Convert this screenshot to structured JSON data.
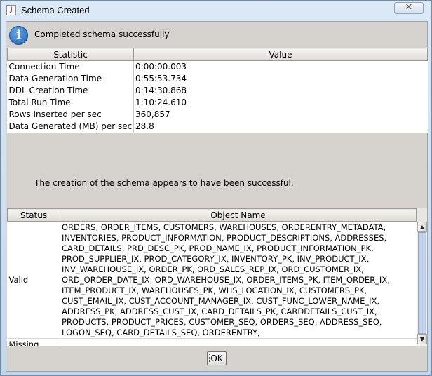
{
  "window": {
    "title": "Schema Created",
    "close_glyph": "✕"
  },
  "info": {
    "icon": "info-icon",
    "glyph": "i",
    "message": "Completed schema successfully"
  },
  "stats": {
    "headers": [
      "Statistic",
      "Value"
    ],
    "rows": [
      {
        "statistic": "Connection Time",
        "value": "0:00:00.003"
      },
      {
        "statistic": "Data Generation Time",
        "value": "0:55:53.734"
      },
      {
        "statistic": "DDL Creation Time",
        "value": "0:14:30.868"
      },
      {
        "statistic": "Total Run Time",
        "value": "1:10:24.610"
      },
      {
        "statistic": "Rows Inserted per sec",
        "value": "360,857"
      },
      {
        "statistic": "Data Generated (MB) per sec",
        "value": "28.8"
      }
    ]
  },
  "summary_message": "The creation of the schema appears to have been successful.",
  "objects": {
    "headers": [
      "Status",
      "Object Name"
    ],
    "rows": [
      {
        "status": "Valid",
        "lines": [
          "ORDERS, ORDER_ITEMS, CUSTOMERS, WAREHOUSES, ORDERENTRY_METADATA,",
          "INVENTORIES, PRODUCT_INFORMATION, PRODUCT_DESCRIPTIONS, ADDRESSES,",
          "CARD_DETAILS, PRD_DESC_PK, PROD_NAME_IX, PRODUCT_INFORMATION_PK,",
          "PROD_SUPPLIER_IX, PROD_CATEGORY_IX, INVENTORY_PK, INV_PRODUCT_IX,",
          "INV_WAREHOUSE_IX, ORDER_PK, ORD_SALES_REP_IX, ORD_CUSTOMER_IX,",
          "ORD_ORDER_DATE_IX, ORD_WAREHOUSE_IX, ORDER_ITEMS_PK, ITEM_ORDER_IX,",
          "ITEM_PRODUCT_IX, WAREHOUSES_PK, WHS_LOCATION_IX, CUSTOMERS_PK,",
          "CUST_EMAIL_IX, CUST_ACCOUNT_MANAGER_IX, CUST_FUNC_LOWER_NAME_IX,",
          "ADDRESS_PK, ADDRESS_CUST_IX, CARD_DETAILS_PK, CARDDETAILS_CUST_IX,",
          "PRODUCTS, PRODUCT_PRICES, CUSTOMER_SEQ, ORDERS_SEQ, ADDRESS_SEQ,",
          "LOGON_SEQ, CARD_DETAILS_SEQ, ORDERENTRY,"
        ]
      },
      {
        "status": "Missing",
        "lines": [
          ""
        ]
      }
    ],
    "scroll_up_glyph": "▲",
    "scroll_down_glyph": "▼"
  },
  "buttons": {
    "ok": "OK"
  }
}
